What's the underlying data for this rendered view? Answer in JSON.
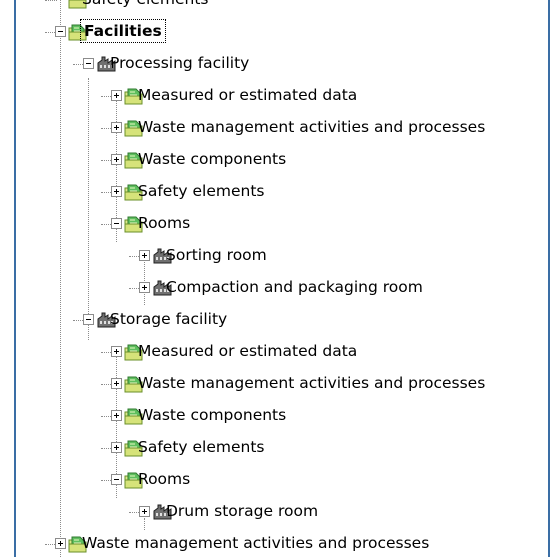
{
  "tree": {
    "rows": [
      {
        "label": "Safety elements",
        "icon": "folder-leaf-icon",
        "expander": "none",
        "level": 0
      },
      {
        "label": "Facilities",
        "icon": "folder-leaf-icon",
        "expander": "minus",
        "level": 0,
        "bold": true,
        "selected": true
      },
      {
        "label": "Processing facility",
        "icon": "facility-icon",
        "expander": "minus",
        "level": 1
      },
      {
        "label": "Measured or estimated data",
        "icon": "folder-leaf-icon",
        "expander": "plus",
        "level": 2
      },
      {
        "label": "Waste management activities and processes",
        "icon": "folder-leaf-icon",
        "expander": "plus",
        "level": 2
      },
      {
        "label": "Waste components",
        "icon": "folder-leaf-icon",
        "expander": "plus",
        "level": 2
      },
      {
        "label": "Safety elements",
        "icon": "folder-leaf-icon",
        "expander": "plus",
        "level": 2
      },
      {
        "label": "Rooms",
        "icon": "folder-leaf-icon",
        "expander": "minus",
        "level": 2
      },
      {
        "label": "Sorting room",
        "icon": "facility-icon",
        "expander": "plus",
        "level": 3
      },
      {
        "label": "Compaction and packaging room",
        "icon": "facility-icon",
        "expander": "plus",
        "level": 3
      },
      {
        "label": "Storage facility",
        "icon": "facility-icon",
        "expander": "minus",
        "level": 1
      },
      {
        "label": "Measured or estimated data",
        "icon": "folder-leaf-icon",
        "expander": "plus",
        "level": 2
      },
      {
        "label": "Waste management activities and processes",
        "icon": "folder-leaf-icon",
        "expander": "plus",
        "level": 2
      },
      {
        "label": "Waste components",
        "icon": "folder-leaf-icon",
        "expander": "plus",
        "level": 2
      },
      {
        "label": "Safety elements",
        "icon": "folder-leaf-icon",
        "expander": "plus",
        "level": 2
      },
      {
        "label": "Rooms",
        "icon": "folder-leaf-icon",
        "expander": "minus",
        "level": 2
      },
      {
        "label": "Drum storage room",
        "icon": "facility-icon",
        "expander": "plus",
        "level": 3
      },
      {
        "label": "Waste management activities and processes",
        "icon": "folder-leaf-icon",
        "expander": "plus",
        "level": 0
      }
    ]
  },
  "colors": {
    "frame": "#3a6ea5",
    "folder_green": "#3fae3f",
    "folder_yellow": "#e8e36a"
  }
}
